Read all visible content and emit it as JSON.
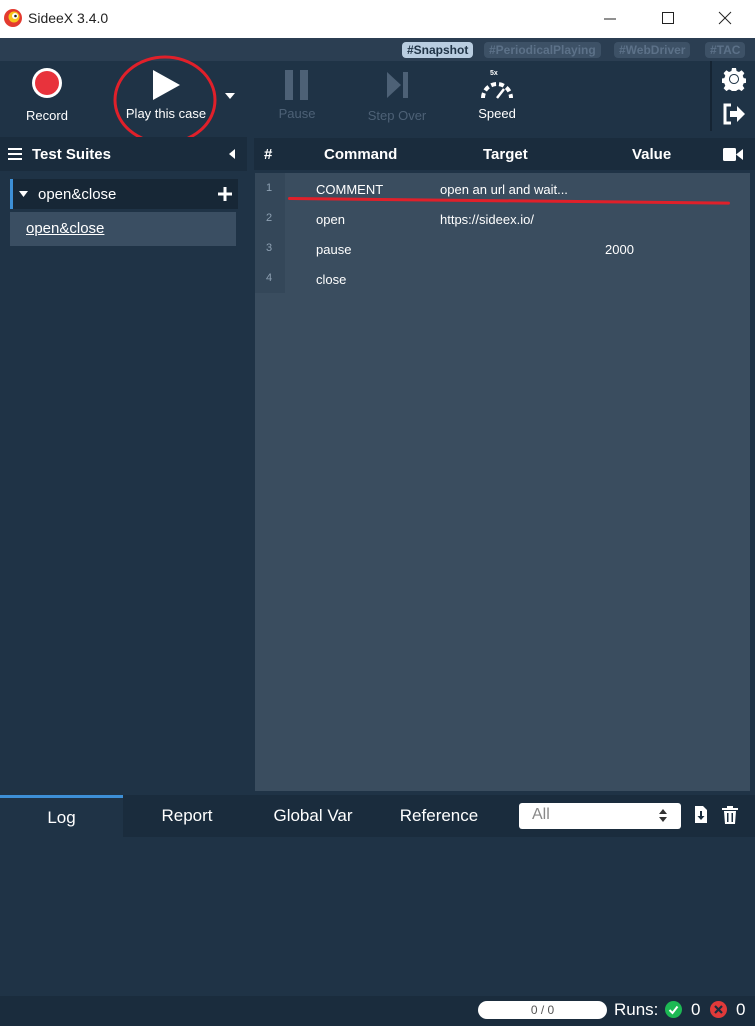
{
  "window": {
    "title": "SideeX 3.4.0"
  },
  "tags": [
    "#Snapshot",
    "#PeriodicalPlaying",
    "#WebDriver",
    "#TAC"
  ],
  "toolbar": {
    "record": "Record",
    "play": "Play this case",
    "pause": "Pause",
    "step_over": "Step Over",
    "speed": "Speed",
    "speed_badge": "5x"
  },
  "suites": {
    "title": "Test Suites",
    "suite_name": "open&close",
    "case_name": "open&close"
  },
  "commands": {
    "headers": {
      "num": "#",
      "command": "Command",
      "target": "Target",
      "value": "Value"
    },
    "rows": [
      {
        "num": "1",
        "command": "COMMENT",
        "target": "open an url and wait...",
        "value": ""
      },
      {
        "num": "2",
        "command": "open",
        "target": "https://sideex.io/",
        "value": ""
      },
      {
        "num": "3",
        "command": "pause",
        "target": "",
        "value": "2000"
      },
      {
        "num": "4",
        "command": "close",
        "target": "",
        "value": ""
      }
    ]
  },
  "bottom": {
    "tabs": [
      "Log",
      "Report",
      "Global Var",
      "Reference"
    ],
    "filter": "All"
  },
  "status": {
    "progress": "0 / 0",
    "runs_label": "Runs:",
    "passed": "0",
    "failed": "0"
  },
  "colors": {
    "background": "#1f3346",
    "record_red": "#e8333c",
    "annotation_red": "#e0202a",
    "pass_green": "#1db954",
    "fail_red": "#e03a3a"
  }
}
